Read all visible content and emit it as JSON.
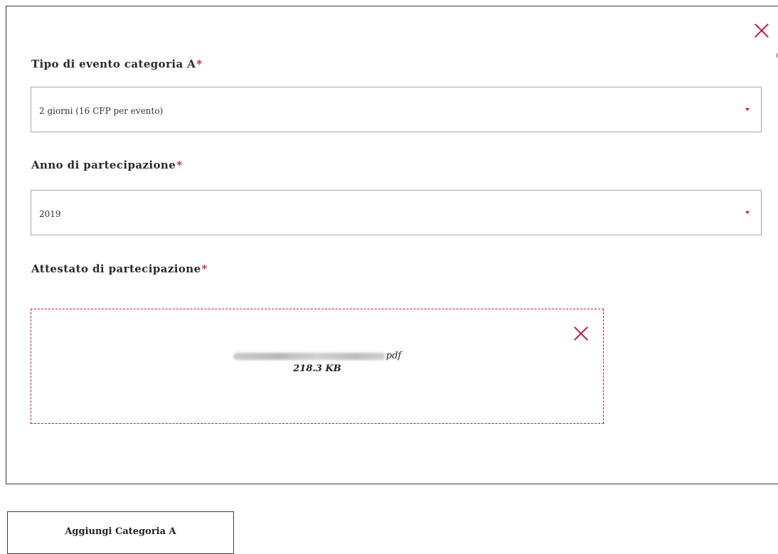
{
  "form": {
    "tipo_evento": {
      "label": "Tipo di evento categoria A",
      "required_mark": "*",
      "value": "2 giorni (16 CFP per evento)"
    },
    "anno": {
      "label": "Anno di partecipazione",
      "required_mark": "*",
      "value": "2019"
    },
    "attestato": {
      "label": "Attestato di partecipazione",
      "required_mark": "*",
      "file": {
        "extension": "pdf",
        "size": "218.3 KB"
      }
    }
  },
  "actions": {
    "add_label": "Aggiungi Categoria A"
  },
  "colors": {
    "accent": "#c4164a",
    "border": "#3a3a3a",
    "select_border": "#a8a8a8"
  },
  "icons": {
    "close": "close-icon",
    "dropdown": "caret-down-icon"
  }
}
